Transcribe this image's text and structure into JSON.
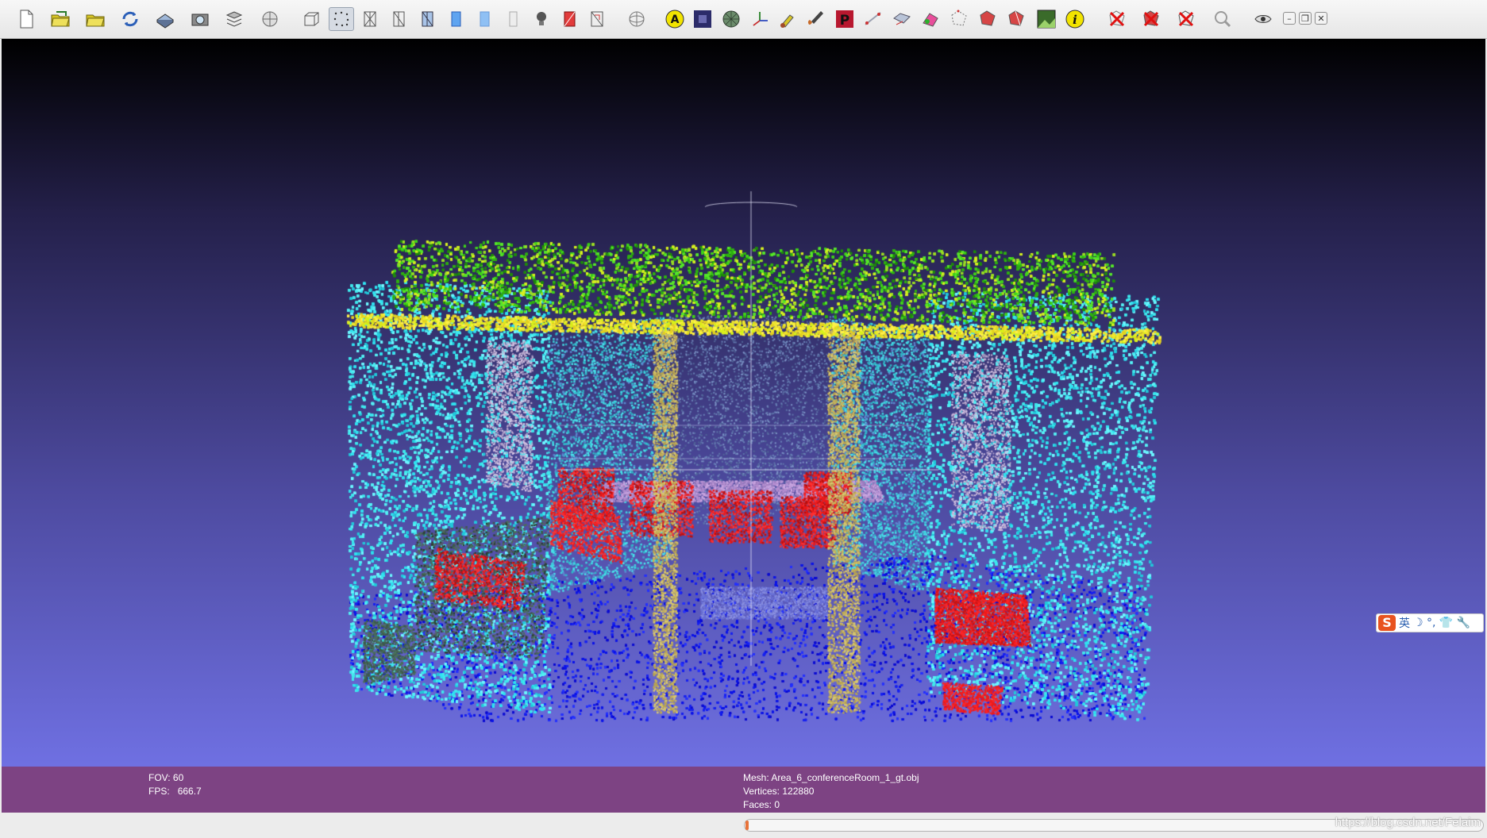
{
  "toolbar": {
    "buttons": [
      {
        "name": "new-project-button",
        "icon": "new-document-icon",
        "active": false
      },
      {
        "name": "open-project-button",
        "icon": "open-folder-icon",
        "active": false
      },
      {
        "name": "import-mesh-button",
        "icon": "folder-icon",
        "active": false
      },
      {
        "name": "reload-button",
        "icon": "reload-icon",
        "active": false
      },
      {
        "name": "export-mesh-button",
        "icon": "save-disk-icon",
        "active": false
      },
      {
        "name": "snapshot-button",
        "icon": "camera-icon",
        "active": false
      },
      {
        "name": "layers-button",
        "icon": "layers-icon",
        "active": false
      },
      {
        "name": "raster-button",
        "icon": "globe-layer-icon",
        "active": false
      },
      {
        "name": "bbox-render-button",
        "icon": "bounding-box-icon",
        "active": false
      },
      {
        "name": "points-render-button",
        "icon": "points-icon",
        "active": true
      },
      {
        "name": "wireframe-render-button",
        "icon": "wireframe-icon",
        "active": false
      },
      {
        "name": "hiddenlines-render-button",
        "icon": "hidden-lines-icon",
        "active": false
      },
      {
        "name": "flatlines-render-button",
        "icon": "flat-lines-icon",
        "active": false
      },
      {
        "name": "flat-render-button",
        "icon": "flat-shading-icon",
        "active": false
      },
      {
        "name": "smooth-render-button",
        "icon": "smooth-shading-icon",
        "active": false
      },
      {
        "name": "texture-render-button",
        "icon": "texture-icon",
        "active": false
      },
      {
        "name": "lighting-button",
        "icon": "light-bulb-icon",
        "active": false
      },
      {
        "name": "backface-button",
        "icon": "backface-icon",
        "active": false
      },
      {
        "name": "selected-faces-button",
        "icon": "cage-icon",
        "active": false
      },
      {
        "name": "trackball-button",
        "icon": "trackball-icon",
        "active": false
      },
      {
        "name": "label-area-button",
        "icon": "annotation-a-icon",
        "active": false
      },
      {
        "name": "quality-histogram-button",
        "icon": "histogram-icon",
        "active": false
      },
      {
        "name": "normals-render-button",
        "icon": "sphere-icon",
        "active": false
      },
      {
        "name": "axes-button",
        "icon": "axes-icon",
        "active": false
      },
      {
        "name": "paint-button",
        "icon": "paint-icon",
        "active": false
      },
      {
        "name": "brush-button",
        "icon": "brush-icon",
        "active": false
      },
      {
        "name": "pick-points-button",
        "icon": "p-marker-icon",
        "active": false
      },
      {
        "name": "measure-button",
        "icon": "measure-icon",
        "active": false
      },
      {
        "name": "align-button",
        "icon": "align-icon",
        "active": false
      },
      {
        "name": "colorize-button",
        "icon": "colorize-icon",
        "active": false
      },
      {
        "name": "select-vertices-button",
        "icon": "select-vertices-icon",
        "active": false
      },
      {
        "name": "select-faces-button",
        "icon": "select-faces-icon",
        "active": false
      },
      {
        "name": "select-connected-button",
        "icon": "select-connected-icon",
        "active": false
      },
      {
        "name": "raster-align-button",
        "icon": "raster-align-icon",
        "active": false
      },
      {
        "name": "info-button",
        "icon": "info-icon",
        "active": false
      },
      {
        "name": "delete-vertices-button",
        "icon": "delete-vertices-icon",
        "active": false
      },
      {
        "name": "delete-faces-button",
        "icon": "delete-faces-icon",
        "active": false
      },
      {
        "name": "delete-both-button",
        "icon": "delete-selection-icon",
        "active": false
      },
      {
        "name": "zoom-button",
        "icon": "magnifier-icon",
        "active": false
      },
      {
        "name": "eye-button",
        "icon": "eye-icon",
        "active": false
      }
    ],
    "window_controls": [
      {
        "name": "minimize-button",
        "glyph": "–"
      },
      {
        "name": "restore-button",
        "glyph": "❐"
      },
      {
        "name": "close-button",
        "glyph": "✕"
      }
    ]
  },
  "scene": {
    "background_top": "#000000",
    "background_bottom": "#6f70e2",
    "colors": {
      "wall": "#3fe8ec",
      "ceiling": "#3fd219",
      "ceiling_light": "#d6f21a",
      "beam": "#f0e630",
      "floor": "#0a12e8",
      "chair": "#ec1a1a",
      "table": "#b48ed0",
      "door": "#c8b45a",
      "window": "#c9b7d8",
      "clutter": "#3d5a4a",
      "board": "#7b8fb8"
    }
  },
  "info": {
    "fov_label": "FOV:",
    "fov_value": "60",
    "fps_label": "FPS:",
    "fps_value": "666.7",
    "mesh_label": "Mesh:",
    "mesh_value": "Area_6_conferenceRoom_1_gt.obj",
    "vertices_label": "Vertices:",
    "vertices_value": "122880",
    "faces_label": "Faces:",
    "faces_value": "0"
  },
  "status": {
    "progress_fraction": 0.003,
    "progress_color": "#e8733a",
    "watermark": "https://blog.csdn.net/Felaim"
  },
  "ime": {
    "logo": "S",
    "lang": "英",
    "glyphs": "☽ °, 👕 🔧"
  }
}
